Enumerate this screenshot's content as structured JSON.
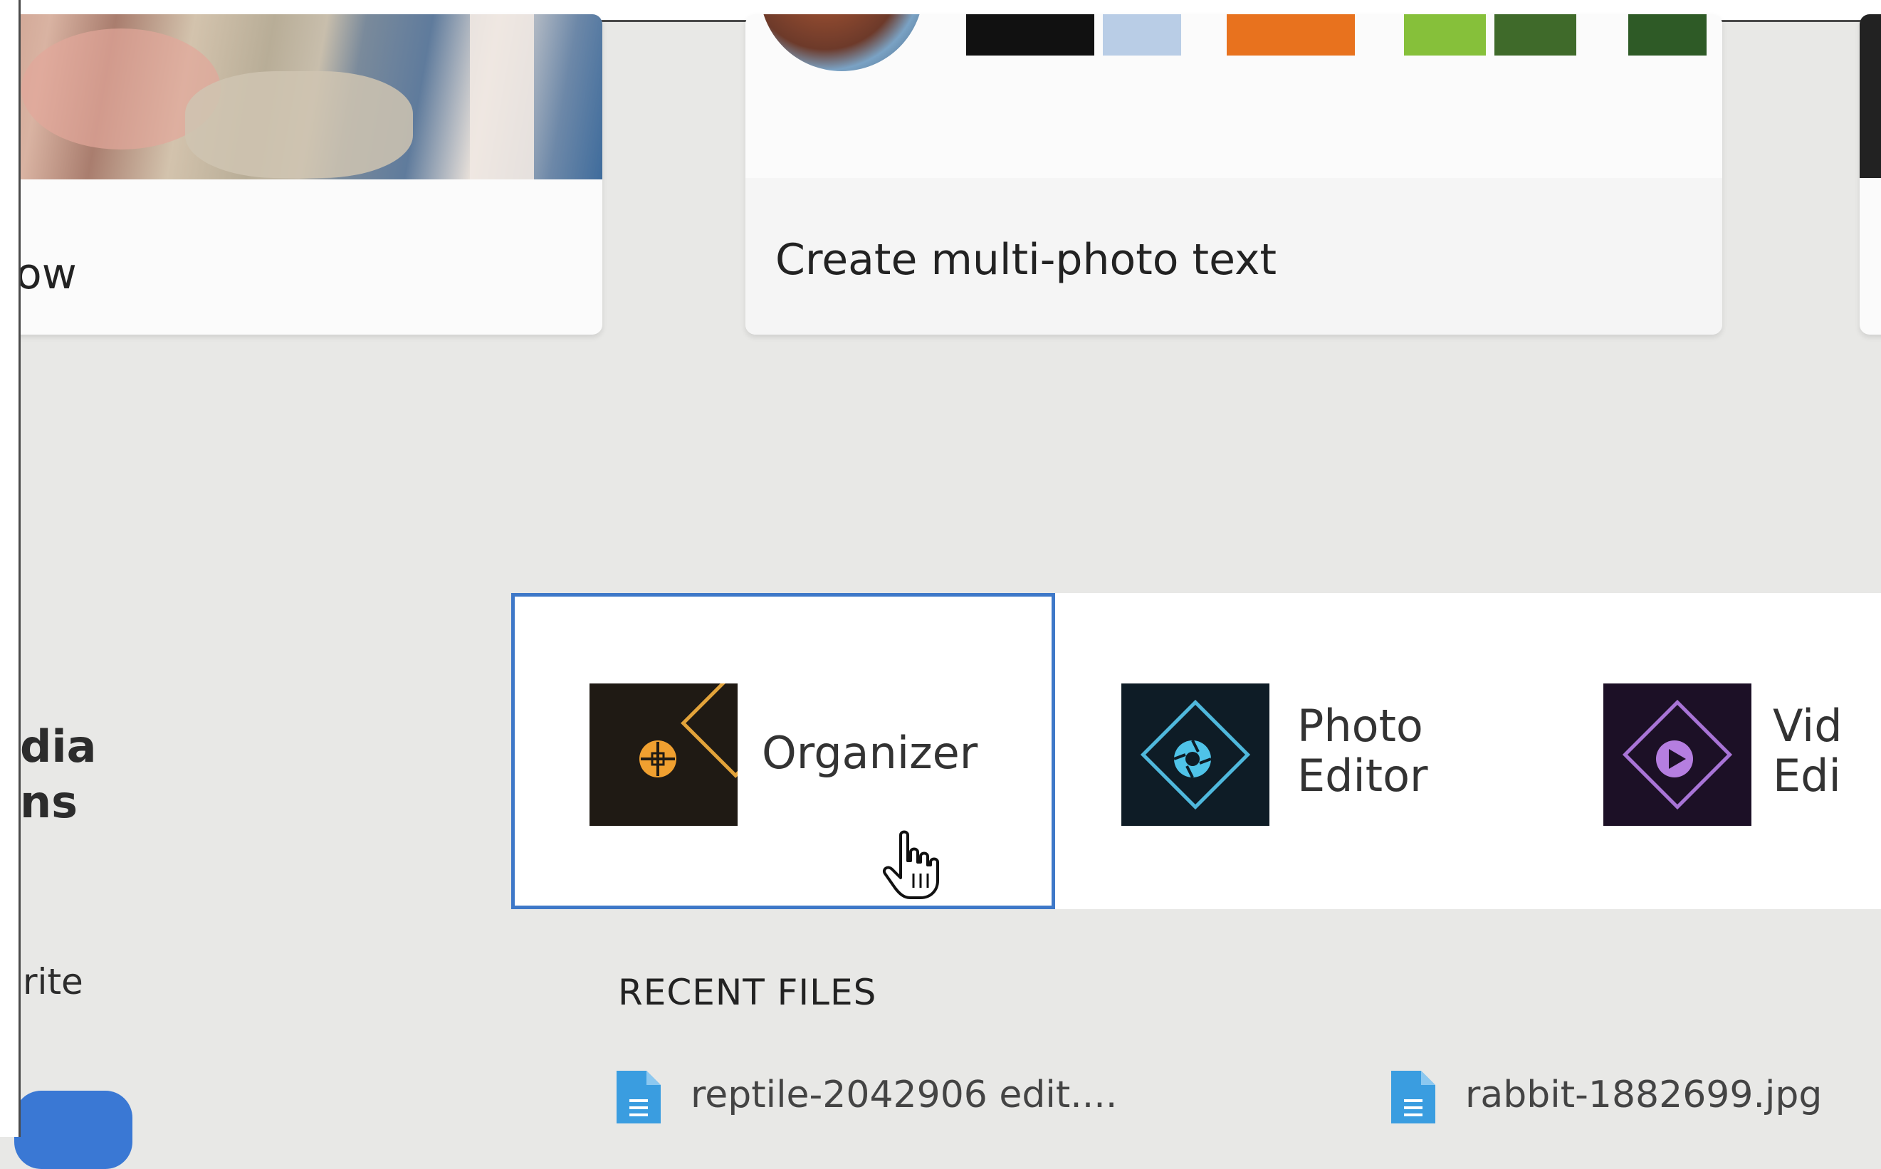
{
  "top_cards": [
    {
      "title": "ow"
    },
    {
      "title": "Create multi-photo text"
    }
  ],
  "apps": [
    {
      "label_lines": [
        "Organizer"
      ],
      "icon": "organizer-icon",
      "selected": true,
      "icon_bg": "#1f1a14",
      "icon_color": "#f0a030"
    },
    {
      "label_lines": [
        "Photo",
        "Editor"
      ],
      "icon": "photo-editor-icon",
      "selected": false,
      "icon_bg": "#0e1c26",
      "icon_color": "#4fc3e8"
    },
    {
      "label_lines": [
        "Vid",
        "Edi"
      ],
      "icon": "video-editor-icon",
      "selected": false,
      "icon_bg": "#1c1026",
      "icon_color": "#b57ee0"
    }
  ],
  "sidebar": {
    "heading_lines": [
      "dia",
      "ns"
    ],
    "favorite_text": "rite"
  },
  "recent_files": {
    "heading": "RECENT FILES",
    "items": [
      {
        "name": "reptile-2042906 edit...."
      },
      {
        "name": "rabbit-1882699.jpg"
      }
    ]
  },
  "colors": {
    "selection_outline": "#3e78c8",
    "background": "#e8e8e6",
    "file_icon": "#3a9de0",
    "side_button": "#3a78d4"
  }
}
